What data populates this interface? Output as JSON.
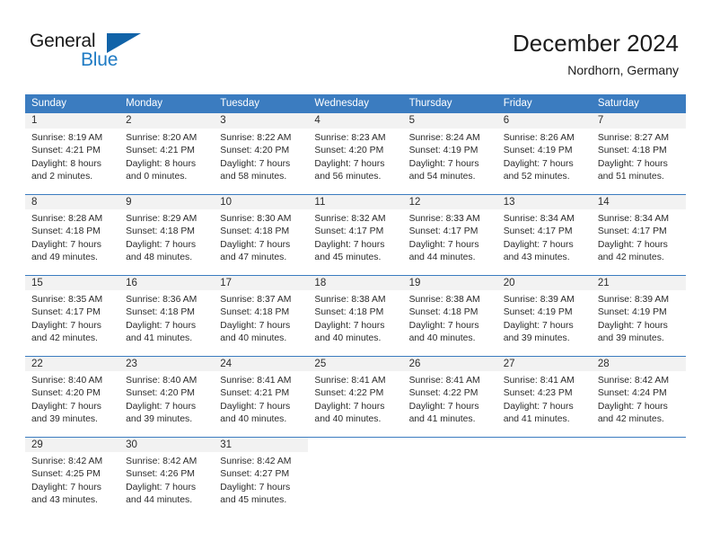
{
  "brand": {
    "name_part1": "General",
    "name_part2": "Blue",
    "accent_color": "#1f7bc4",
    "mark_color": "#1163a8",
    "logo_icon": "triangle-flag-icon"
  },
  "header": {
    "title": "December 2024",
    "subtitle": "Nordhorn, Germany"
  },
  "theme": {
    "header_row_bg": "#3b7cc0",
    "day_band_bg": "#f2f2f2",
    "text_color": "#2b2b2b"
  },
  "weekday_headers": [
    "Sunday",
    "Monday",
    "Tuesday",
    "Wednesday",
    "Thursday",
    "Friday",
    "Saturday"
  ],
  "weeks": [
    [
      {
        "day": "1",
        "sunrise": "Sunrise: 8:19 AM",
        "sunset": "Sunset: 4:21 PM",
        "daylight_line1": "Daylight: 8 hours",
        "daylight_line2": "and 2 minutes."
      },
      {
        "day": "2",
        "sunrise": "Sunrise: 8:20 AM",
        "sunset": "Sunset: 4:21 PM",
        "daylight_line1": "Daylight: 8 hours",
        "daylight_line2": "and 0 minutes."
      },
      {
        "day": "3",
        "sunrise": "Sunrise: 8:22 AM",
        "sunset": "Sunset: 4:20 PM",
        "daylight_line1": "Daylight: 7 hours",
        "daylight_line2": "and 58 minutes."
      },
      {
        "day": "4",
        "sunrise": "Sunrise: 8:23 AM",
        "sunset": "Sunset: 4:20 PM",
        "daylight_line1": "Daylight: 7 hours",
        "daylight_line2": "and 56 minutes."
      },
      {
        "day": "5",
        "sunrise": "Sunrise: 8:24 AM",
        "sunset": "Sunset: 4:19 PM",
        "daylight_line1": "Daylight: 7 hours",
        "daylight_line2": "and 54 minutes."
      },
      {
        "day": "6",
        "sunrise": "Sunrise: 8:26 AM",
        "sunset": "Sunset: 4:19 PM",
        "daylight_line1": "Daylight: 7 hours",
        "daylight_line2": "and 52 minutes."
      },
      {
        "day": "7",
        "sunrise": "Sunrise: 8:27 AM",
        "sunset": "Sunset: 4:18 PM",
        "daylight_line1": "Daylight: 7 hours",
        "daylight_line2": "and 51 minutes."
      }
    ],
    [
      {
        "day": "8",
        "sunrise": "Sunrise: 8:28 AM",
        "sunset": "Sunset: 4:18 PM",
        "daylight_line1": "Daylight: 7 hours",
        "daylight_line2": "and 49 minutes."
      },
      {
        "day": "9",
        "sunrise": "Sunrise: 8:29 AM",
        "sunset": "Sunset: 4:18 PM",
        "daylight_line1": "Daylight: 7 hours",
        "daylight_line2": "and 48 minutes."
      },
      {
        "day": "10",
        "sunrise": "Sunrise: 8:30 AM",
        "sunset": "Sunset: 4:18 PM",
        "daylight_line1": "Daylight: 7 hours",
        "daylight_line2": "and 47 minutes."
      },
      {
        "day": "11",
        "sunrise": "Sunrise: 8:32 AM",
        "sunset": "Sunset: 4:17 PM",
        "daylight_line1": "Daylight: 7 hours",
        "daylight_line2": "and 45 minutes."
      },
      {
        "day": "12",
        "sunrise": "Sunrise: 8:33 AM",
        "sunset": "Sunset: 4:17 PM",
        "daylight_line1": "Daylight: 7 hours",
        "daylight_line2": "and 44 minutes."
      },
      {
        "day": "13",
        "sunrise": "Sunrise: 8:34 AM",
        "sunset": "Sunset: 4:17 PM",
        "daylight_line1": "Daylight: 7 hours",
        "daylight_line2": "and 43 minutes."
      },
      {
        "day": "14",
        "sunrise": "Sunrise: 8:34 AM",
        "sunset": "Sunset: 4:17 PM",
        "daylight_line1": "Daylight: 7 hours",
        "daylight_line2": "and 42 minutes."
      }
    ],
    [
      {
        "day": "15",
        "sunrise": "Sunrise: 8:35 AM",
        "sunset": "Sunset: 4:17 PM",
        "daylight_line1": "Daylight: 7 hours",
        "daylight_line2": "and 42 minutes."
      },
      {
        "day": "16",
        "sunrise": "Sunrise: 8:36 AM",
        "sunset": "Sunset: 4:18 PM",
        "daylight_line1": "Daylight: 7 hours",
        "daylight_line2": "and 41 minutes."
      },
      {
        "day": "17",
        "sunrise": "Sunrise: 8:37 AM",
        "sunset": "Sunset: 4:18 PM",
        "daylight_line1": "Daylight: 7 hours",
        "daylight_line2": "and 40 minutes."
      },
      {
        "day": "18",
        "sunrise": "Sunrise: 8:38 AM",
        "sunset": "Sunset: 4:18 PM",
        "daylight_line1": "Daylight: 7 hours",
        "daylight_line2": "and 40 minutes."
      },
      {
        "day": "19",
        "sunrise": "Sunrise: 8:38 AM",
        "sunset": "Sunset: 4:18 PM",
        "daylight_line1": "Daylight: 7 hours",
        "daylight_line2": "and 40 minutes."
      },
      {
        "day": "20",
        "sunrise": "Sunrise: 8:39 AM",
        "sunset": "Sunset: 4:19 PM",
        "daylight_line1": "Daylight: 7 hours",
        "daylight_line2": "and 39 minutes."
      },
      {
        "day": "21",
        "sunrise": "Sunrise: 8:39 AM",
        "sunset": "Sunset: 4:19 PM",
        "daylight_line1": "Daylight: 7 hours",
        "daylight_line2": "and 39 minutes."
      }
    ],
    [
      {
        "day": "22",
        "sunrise": "Sunrise: 8:40 AM",
        "sunset": "Sunset: 4:20 PM",
        "daylight_line1": "Daylight: 7 hours",
        "daylight_line2": "and 39 minutes."
      },
      {
        "day": "23",
        "sunrise": "Sunrise: 8:40 AM",
        "sunset": "Sunset: 4:20 PM",
        "daylight_line1": "Daylight: 7 hours",
        "daylight_line2": "and 39 minutes."
      },
      {
        "day": "24",
        "sunrise": "Sunrise: 8:41 AM",
        "sunset": "Sunset: 4:21 PM",
        "daylight_line1": "Daylight: 7 hours",
        "daylight_line2": "and 40 minutes."
      },
      {
        "day": "25",
        "sunrise": "Sunrise: 8:41 AM",
        "sunset": "Sunset: 4:22 PM",
        "daylight_line1": "Daylight: 7 hours",
        "daylight_line2": "and 40 minutes."
      },
      {
        "day": "26",
        "sunrise": "Sunrise: 8:41 AM",
        "sunset": "Sunset: 4:22 PM",
        "daylight_line1": "Daylight: 7 hours",
        "daylight_line2": "and 41 minutes."
      },
      {
        "day": "27",
        "sunrise": "Sunrise: 8:41 AM",
        "sunset": "Sunset: 4:23 PM",
        "daylight_line1": "Daylight: 7 hours",
        "daylight_line2": "and 41 minutes."
      },
      {
        "day": "28",
        "sunrise": "Sunrise: 8:42 AM",
        "sunset": "Sunset: 4:24 PM",
        "daylight_line1": "Daylight: 7 hours",
        "daylight_line2": "and 42 minutes."
      }
    ],
    [
      {
        "day": "29",
        "sunrise": "Sunrise: 8:42 AM",
        "sunset": "Sunset: 4:25 PM",
        "daylight_line1": "Daylight: 7 hours",
        "daylight_line2": "and 43 minutes."
      },
      {
        "day": "30",
        "sunrise": "Sunrise: 8:42 AM",
        "sunset": "Sunset: 4:26 PM",
        "daylight_line1": "Daylight: 7 hours",
        "daylight_line2": "and 44 minutes."
      },
      {
        "day": "31",
        "sunrise": "Sunrise: 8:42 AM",
        "sunset": "Sunset: 4:27 PM",
        "daylight_line1": "Daylight: 7 hours",
        "daylight_line2": "and 45 minutes."
      },
      {
        "day": "",
        "sunrise": "",
        "sunset": "",
        "daylight_line1": "",
        "daylight_line2": ""
      },
      {
        "day": "",
        "sunrise": "",
        "sunset": "",
        "daylight_line1": "",
        "daylight_line2": ""
      },
      {
        "day": "",
        "sunrise": "",
        "sunset": "",
        "daylight_line1": "",
        "daylight_line2": ""
      },
      {
        "day": "",
        "sunrise": "",
        "sunset": "",
        "daylight_line1": "",
        "daylight_line2": ""
      }
    ]
  ]
}
